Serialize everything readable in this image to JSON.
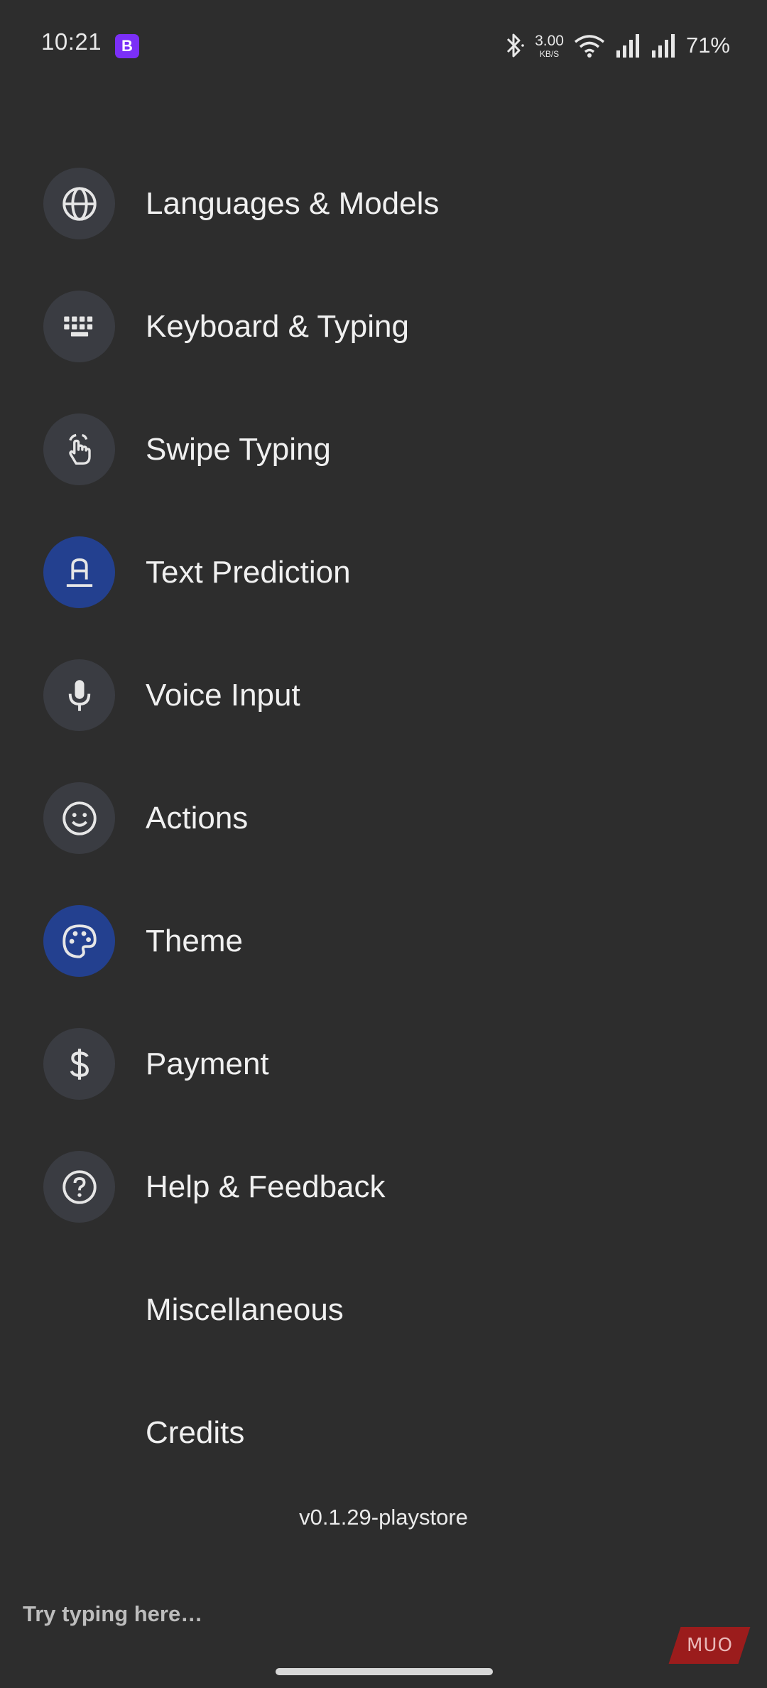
{
  "status_bar": {
    "time": "10:21",
    "app_badge_letter": "B",
    "net_speed_value": "3.00",
    "net_speed_unit": "KB/S",
    "battery": "71%",
    "icons": [
      "bluetooth-icon",
      "wifi-icon",
      "signal-icon",
      "signal-icon"
    ]
  },
  "menu": {
    "items": [
      {
        "label": "Languages & Models",
        "icon": "globe-icon",
        "active": false
      },
      {
        "label": "Keyboard & Typing",
        "icon": "keyboard-icon",
        "active": false
      },
      {
        "label": "Swipe Typing",
        "icon": "swipe-hand-icon",
        "active": false
      },
      {
        "label": "Text Prediction",
        "icon": "text-format-icon",
        "active": true
      },
      {
        "label": "Voice Input",
        "icon": "microphone-icon",
        "active": false
      },
      {
        "label": "Actions",
        "icon": "smiley-icon",
        "active": false
      },
      {
        "label": "Theme",
        "icon": "palette-icon",
        "active": true
      },
      {
        "label": "Payment",
        "icon": "dollar-icon",
        "active": false
      },
      {
        "label": "Help & Feedback",
        "icon": "help-icon",
        "active": false
      },
      {
        "label": "Miscellaneous",
        "icon": "",
        "active": false
      },
      {
        "label": "Credits",
        "icon": "",
        "active": false
      }
    ]
  },
  "version": "v0.1.29-playstore",
  "input": {
    "placeholder": "Try typing here…"
  },
  "watermark": "MUO",
  "colors": {
    "background": "#2d2d2d",
    "icon_circle": "#3a3c42",
    "icon_circle_active": "#23408f",
    "app_badge": "#7b2ff7"
  }
}
